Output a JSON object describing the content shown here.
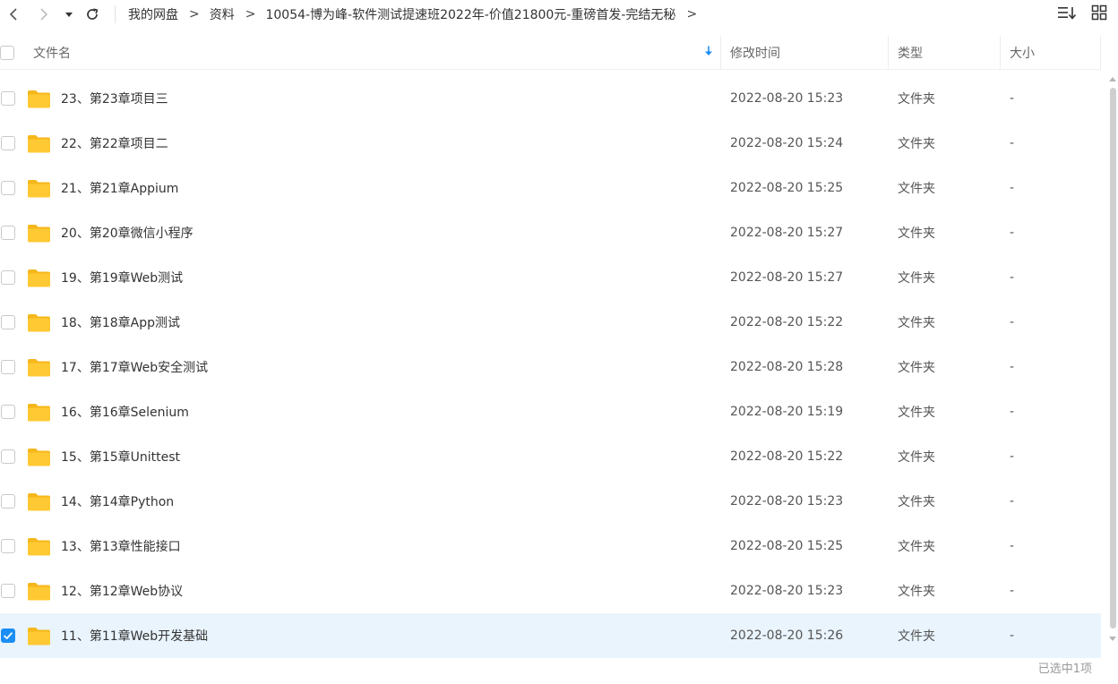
{
  "toolbar": {
    "back_icon": "chevron-left-icon",
    "forward_icon": "chevron-right-icon",
    "history_icon": "caret-down-icon",
    "refresh_icon": "refresh-icon",
    "sort_view_icon": "sort-list-icon",
    "grid_view_icon": "grid-view-icon"
  },
  "breadcrumb": {
    "items": [
      "我的网盘",
      "资料",
      "10054-博为峰-软件测试提速班2022年-价值21800元-重磅首发-完结无秘"
    ],
    "separator": ">"
  },
  "header": {
    "name": "文件名",
    "modified": "修改时间",
    "type": "类型",
    "size": "大小",
    "sort_icon": "arrow-down-icon"
  },
  "rows": [
    {
      "name": "23、第23章项目三",
      "modified": "2022-08-20 15:23",
      "type": "文件夹",
      "size": "-",
      "checked": false
    },
    {
      "name": "22、第22章项目二",
      "modified": "2022-08-20 15:24",
      "type": "文件夹",
      "size": "-",
      "checked": false
    },
    {
      "name": "21、第21章Appium",
      "modified": "2022-08-20 15:25",
      "type": "文件夹",
      "size": "-",
      "checked": false
    },
    {
      "name": "20、第20章微信小程序",
      "modified": "2022-08-20 15:27",
      "type": "文件夹",
      "size": "-",
      "checked": false
    },
    {
      "name": "19、第19章Web测试",
      "modified": "2022-08-20 15:27",
      "type": "文件夹",
      "size": "-",
      "checked": false
    },
    {
      "name": "18、第18章App测试",
      "modified": "2022-08-20 15:22",
      "type": "文件夹",
      "size": "-",
      "checked": false
    },
    {
      "name": "17、第17章Web安全测试",
      "modified": "2022-08-20 15:28",
      "type": "文件夹",
      "size": "-",
      "checked": false
    },
    {
      "name": "16、第16章Selenium",
      "modified": "2022-08-20 15:19",
      "type": "文件夹",
      "size": "-",
      "checked": false
    },
    {
      "name": "15、第15章Unittest",
      "modified": "2022-08-20 15:22",
      "type": "文件夹",
      "size": "-",
      "checked": false
    },
    {
      "name": "14、第14章Python",
      "modified": "2022-08-20 15:23",
      "type": "文件夹",
      "size": "-",
      "checked": false
    },
    {
      "name": "13、第13章性能接口",
      "modified": "2022-08-20 15:25",
      "type": "文件夹",
      "size": "-",
      "checked": false
    },
    {
      "name": "12、第12章Web协议",
      "modified": "2022-08-20 15:23",
      "type": "文件夹",
      "size": "-",
      "checked": false
    },
    {
      "name": "11、第11章Web开发基础",
      "modified": "2022-08-20 15:26",
      "type": "文件夹",
      "size": "-",
      "checked": true
    }
  ],
  "footer": {
    "status": "已选中1项"
  },
  "colors": {
    "accent": "#1b8ef5",
    "selected_row": "#e9f4fd",
    "folder": "#ffc933",
    "folder_tab": "#f5b71b"
  }
}
